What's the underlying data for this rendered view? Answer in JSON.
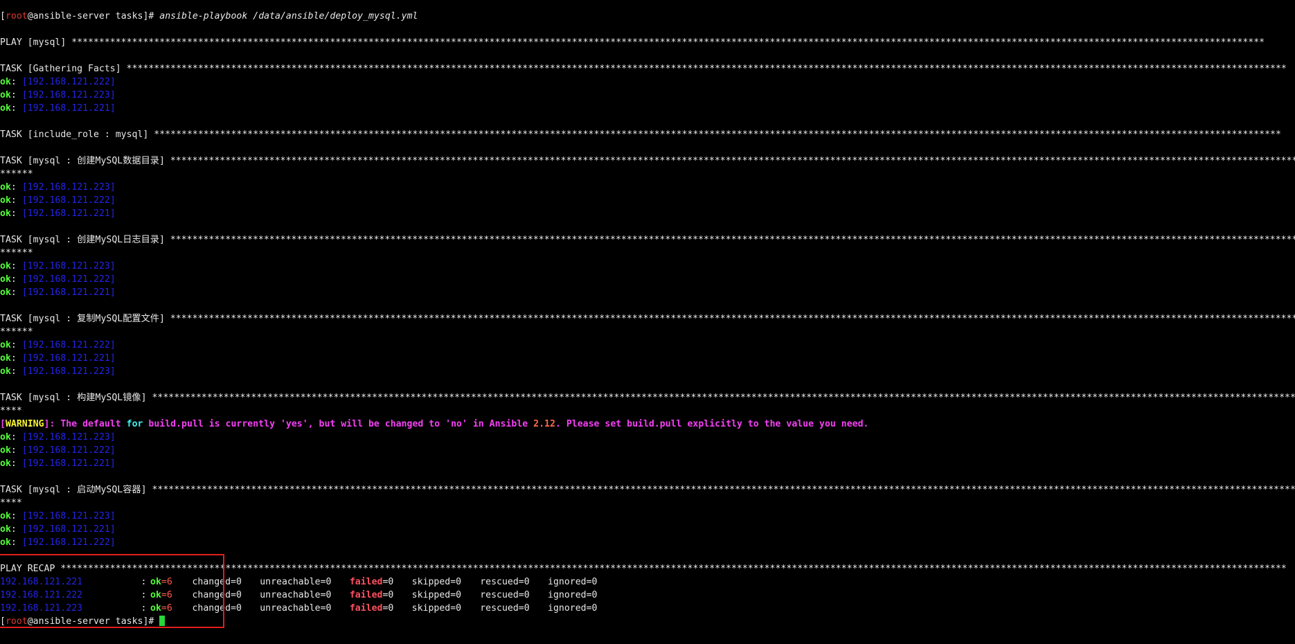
{
  "prompt": {
    "open_bracket": "[",
    "user": "root",
    "at_host": "@ansible-server",
    "dir_close": " tasks]# ",
    "command": "ansible-playbook",
    "arg": " /data/ansible/deploy_mysql.yml"
  },
  "play_header": "PLAY [mysql] *************************************************************************************************************************************************************************************************************************",
  "tasks": [
    {
      "header": "TASK [Gathering Facts] *******************************************************************************************************************************************************************************************************************",
      "wrap": "",
      "results": [
        {
          "status": "ok",
          "host": "192.168.121.222"
        },
        {
          "status": "ok",
          "host": "192.168.121.223"
        },
        {
          "status": "ok",
          "host": "192.168.121.221"
        }
      ]
    },
    {
      "header": "TASK [include_role : mysql] *************************************************************************************************************************************************************************************************************",
      "wrap": "",
      "results": []
    },
    {
      "header": "TASK [mysql : 创建MySQL数据目录] *****************************************************************************************************************************************************************************************************************",
      "wrap": "******",
      "results": [
        {
          "status": "ok",
          "host": "192.168.121.223"
        },
        {
          "status": "ok",
          "host": "192.168.121.222"
        },
        {
          "status": "ok",
          "host": "192.168.121.221"
        }
      ]
    },
    {
      "header": "TASK [mysql : 创建MySQL日志目录] *****************************************************************************************************************************************************************************************************************",
      "wrap": "******",
      "results": [
        {
          "status": "ok",
          "host": "192.168.121.223"
        },
        {
          "status": "ok",
          "host": "192.168.121.222"
        },
        {
          "status": "ok",
          "host": "192.168.121.221"
        }
      ]
    },
    {
      "header": "TASK [mysql : 复制MySQL配置文件] *****************************************************************************************************************************************************************************************************************",
      "wrap": "******",
      "results": [
        {
          "status": "ok",
          "host": "192.168.121.222"
        },
        {
          "status": "ok",
          "host": "192.168.121.221"
        },
        {
          "status": "ok",
          "host": "192.168.121.223"
        }
      ]
    },
    {
      "header": "TASK [mysql : 构建MySQL镜像] *********************************************************************************************************************************************************************************************************************",
      "wrap": "****",
      "warning": {
        "open": "[",
        "label": "WARNING",
        "close": "]: The default ",
        "kw_for": "for",
        "mid": " build.pull is currently 'yes', but will be changed to 'no' in Ansible ",
        "version": "2.12",
        "end": ". Please set build.pull explicitly to the value you need."
      },
      "results": [
        {
          "status": "ok",
          "host": "192.168.121.223"
        },
        {
          "status": "ok",
          "host": "192.168.121.222"
        },
        {
          "status": "ok",
          "host": "192.168.121.221"
        }
      ]
    },
    {
      "header": "TASK [mysql : 启动MySQL容器] *********************************************************************************************************************************************************************************************************************",
      "wrap": "****",
      "results": [
        {
          "status": "ok",
          "host": "192.168.121.223"
        },
        {
          "status": "ok",
          "host": "192.168.121.221"
        },
        {
          "status": "ok",
          "host": "192.168.121.222"
        }
      ]
    }
  ],
  "recap": {
    "header": "PLAY RECAP *******************************************************************************************************************************************************************************************************************************",
    "rows": [
      {
        "host": "192.168.121.221",
        "ok_label": "ok",
        "ok_num": "=6",
        "changed": "changed=0",
        "unreachable": "unreachable=0",
        "failed_label": "failed",
        "failed_num": "=0",
        "skipped": "skipped=0",
        "rescued": "rescued=0",
        "ignored": "ignored=0"
      },
      {
        "host": "192.168.121.222",
        "ok_label": "ok",
        "ok_num": "=6",
        "changed": "changed=0",
        "unreachable": "unreachable=0",
        "failed_label": "failed",
        "failed_num": "=0",
        "skipped": "skipped=0",
        "rescued": "rescued=0",
        "ignored": "ignored=0"
      },
      {
        "host": "192.168.121.223",
        "ok_label": "ok",
        "ok_num": "=6",
        "changed": "changed=0",
        "unreachable": "unreachable=0",
        "failed_label": "failed",
        "failed_num": "=0",
        "skipped": "skipped=0",
        "rescued": "rescued=0",
        "ignored": "ignored=0"
      }
    ]
  },
  "colors": {
    "background": "#000000",
    "ok_green": "#52ff3a",
    "host_blue": "#2424e8",
    "warning_magenta": "#f540f5",
    "highlight_box": "#e21e1e"
  }
}
